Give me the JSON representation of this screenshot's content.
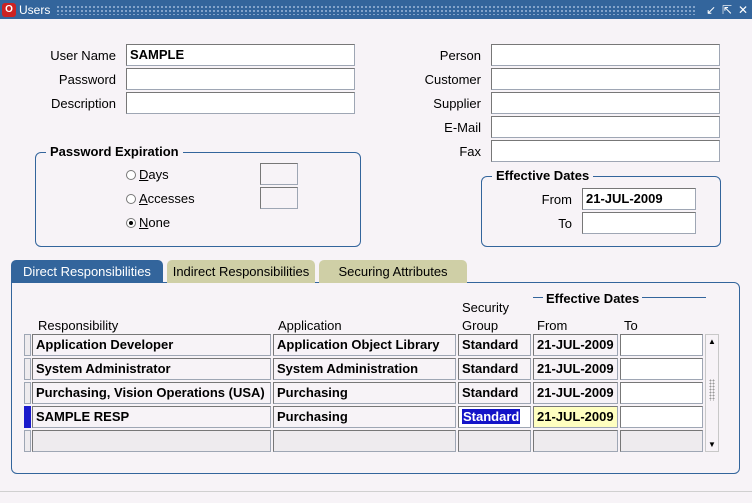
{
  "window": {
    "title": "Users",
    "icon": "oracle-o-icon",
    "controls": [
      "↙",
      "⇱",
      "✕"
    ]
  },
  "user": {
    "user_name_label": "User Name",
    "user_name_value": "SAMPLE",
    "password_label": "Password",
    "password_value": "",
    "description_label": "Description",
    "description_value": ""
  },
  "links": {
    "person_label": "Person",
    "customer_label": "Customer",
    "supplier_label": "Supplier",
    "email_label": "E-Mail",
    "fax_label": "Fax"
  },
  "password_expiration": {
    "title": "Password Expiration",
    "options": [
      {
        "prefix": "",
        "ul": "D",
        "rest": "ays",
        "selected": false
      },
      {
        "prefix": "",
        "ul": "A",
        "rest": "ccesses",
        "selected": false
      },
      {
        "prefix": "",
        "ul": "N",
        "rest": "one",
        "selected": true
      }
    ]
  },
  "effective_dates": {
    "title": "Effective Dates",
    "from_label": "From",
    "from_value": "21-JUL-2009",
    "to_label": "To",
    "to_value": ""
  },
  "tabs": [
    {
      "label": "Direct Responsibilities",
      "active": true
    },
    {
      "label": "Indirect Responsibilities",
      "active": false
    },
    {
      "label": "Securing Attributes",
      "active": false
    }
  ],
  "table": {
    "effective_dates_title": "Effective Dates",
    "headers": {
      "responsibility": "Responsibility",
      "application": "Application",
      "security_line1": "Security",
      "security_line2": "Group",
      "from": "From",
      "to": "To"
    },
    "rows": [
      {
        "responsibility": "Application Developer",
        "application": "Application Object Library",
        "security_group": "Standard",
        "from": "21-JUL-2009",
        "to": ""
      },
      {
        "responsibility": "System Administrator",
        "application": "System Administration",
        "security_group": "Standard",
        "from": "21-JUL-2009",
        "to": ""
      },
      {
        "responsibility": "Purchasing, Vision Operations (USA)",
        "application": "Purchasing",
        "security_group": "Standard",
        "from": "21-JUL-2009",
        "to": ""
      },
      {
        "responsibility": "SAMPLE RESP",
        "application": "Purchasing",
        "security_group": "Standard",
        "from": "21-JUL-2009",
        "to": ""
      }
    ]
  }
}
